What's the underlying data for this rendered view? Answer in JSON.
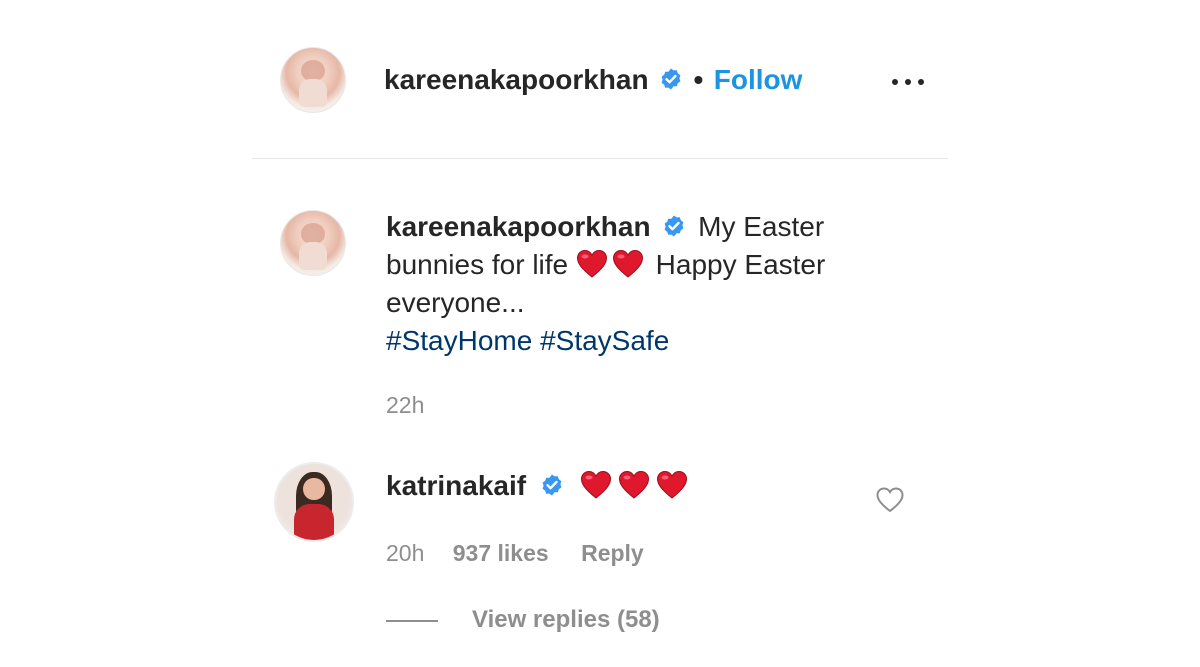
{
  "header": {
    "username": "kareenakapoorkhan",
    "separator": "•",
    "follow_label": "Follow",
    "more_icon": "more-options-icon"
  },
  "caption": {
    "username": "kareenakapoorkhan",
    "text_part1": "My Easter bunnies for life",
    "text_part2": "Happy Easter everyone...",
    "hashtags": "#StayHome #StaySafe",
    "time": "22h"
  },
  "comment": {
    "username": "katrinakaif",
    "emoji_count": 3,
    "time": "20h",
    "likes": "937 likes",
    "reply_label": "Reply",
    "like_icon": "heart-outline-icon"
  },
  "view_replies": {
    "label": "View replies (58)"
  },
  "colors": {
    "link_blue": "#1b95e0",
    "verified_blue": "#3897f0",
    "hashtag": "#00376b",
    "muted": "#8e8e8e",
    "heart_red": "#e0182d"
  }
}
